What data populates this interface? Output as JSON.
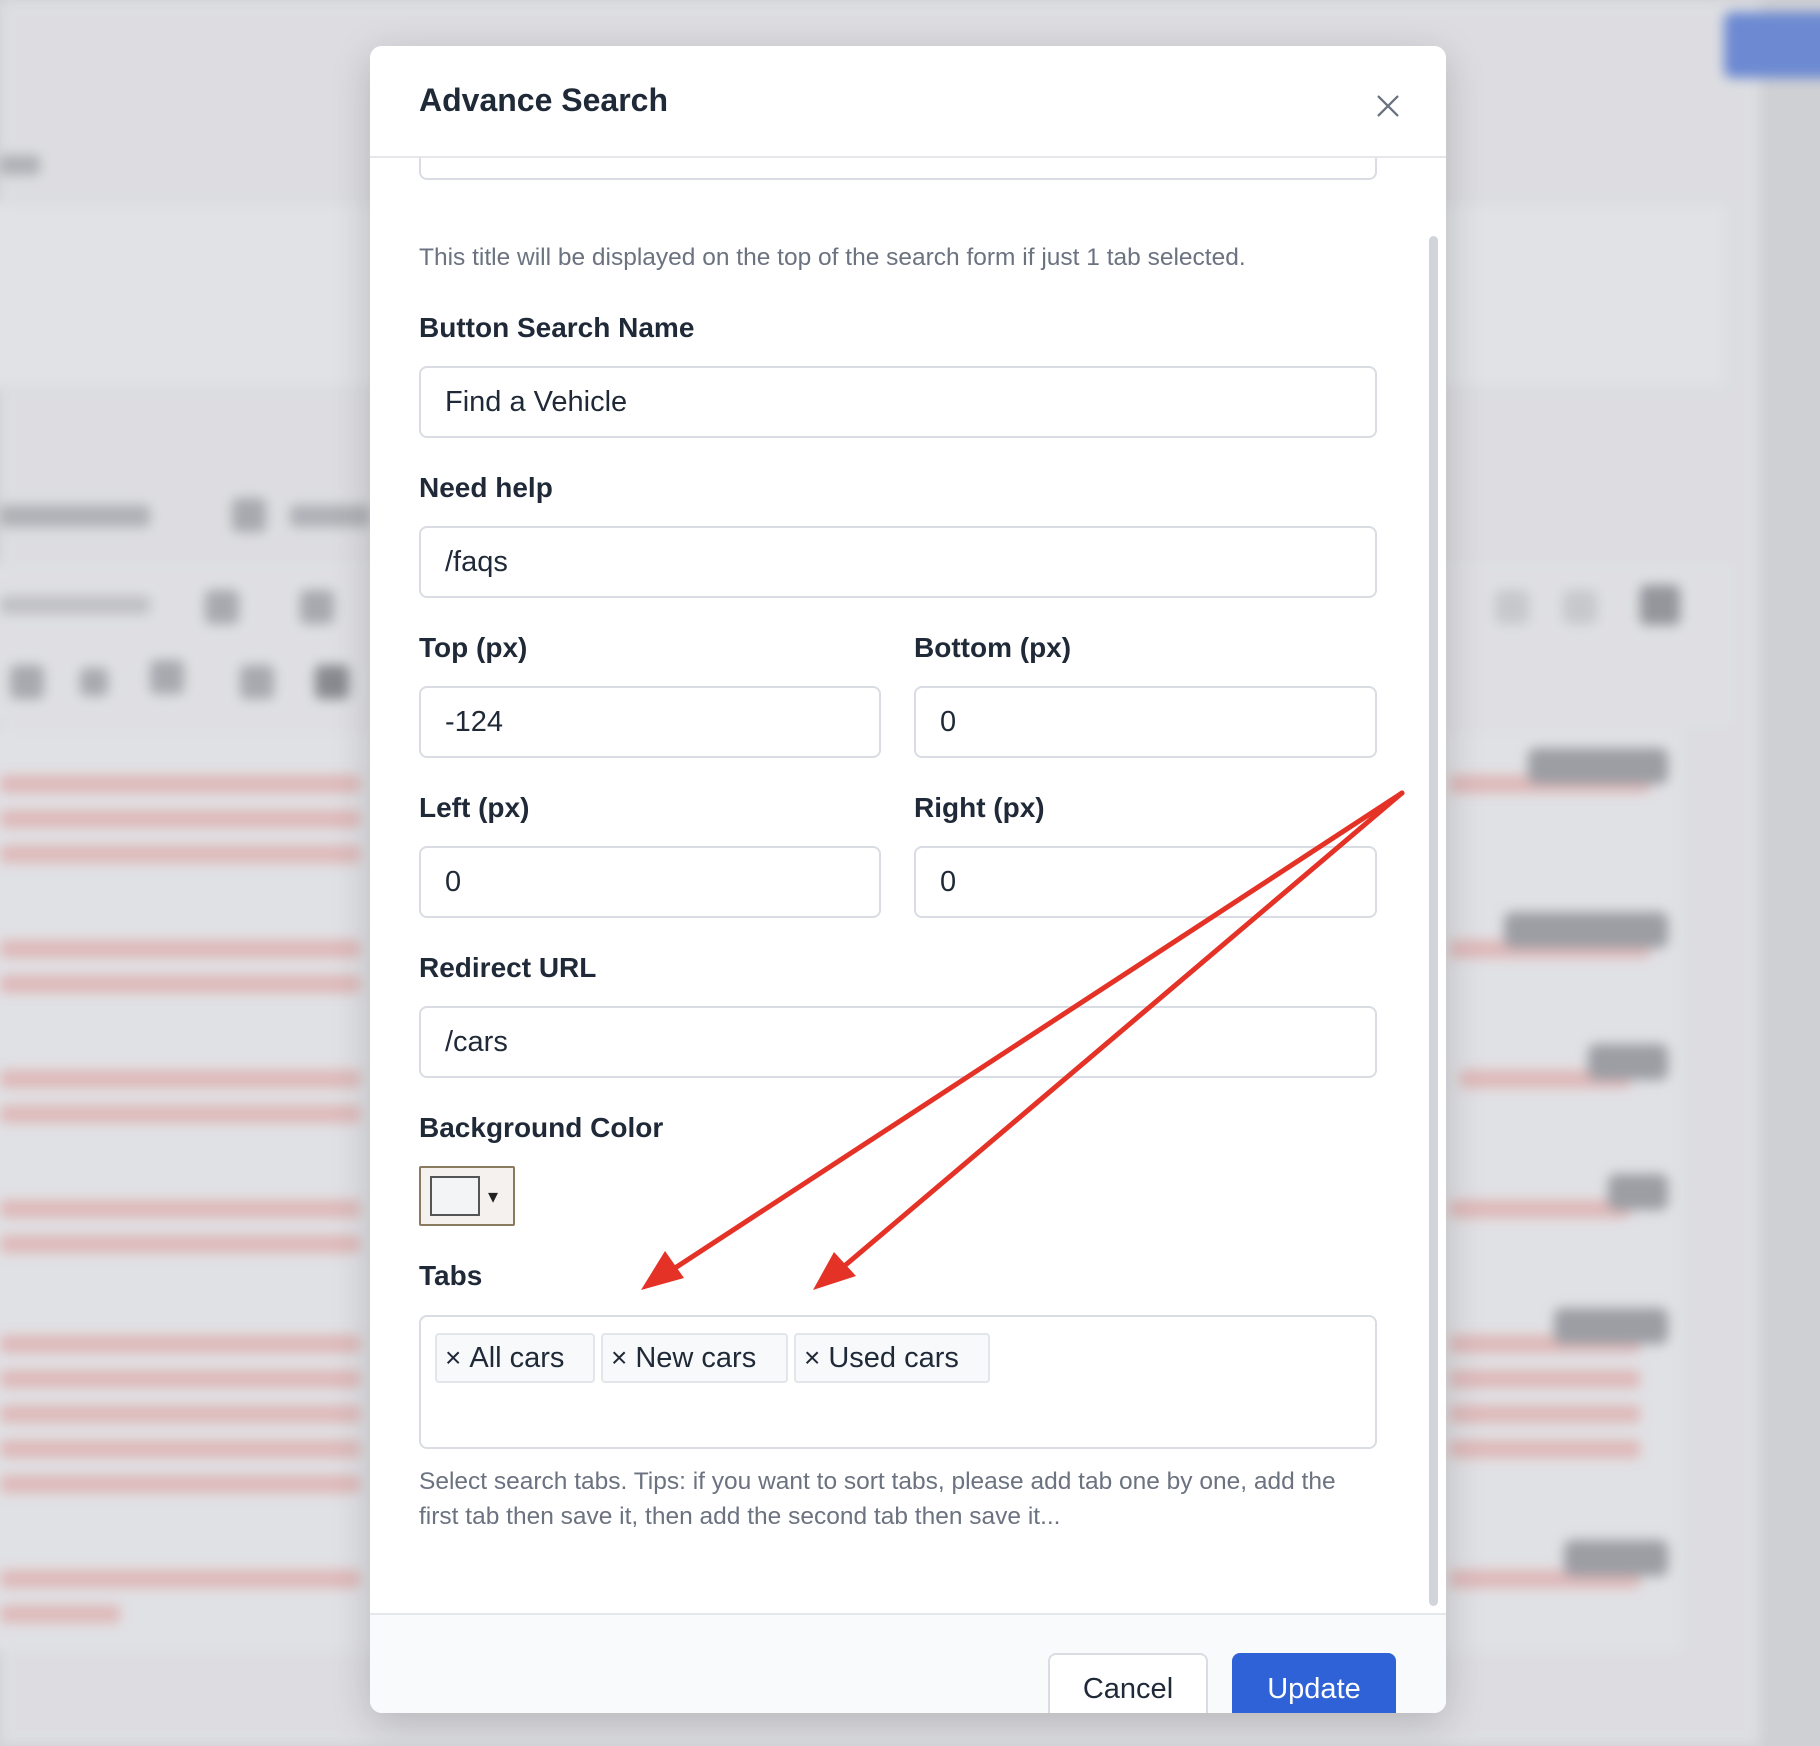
{
  "dialog": {
    "title": "Advance Search",
    "title_hint": "This title will be displayed on the top of the search form if just 1 tab selected."
  },
  "fields": {
    "button_search_name": {
      "label": "Button Search Name",
      "value": "Find a Vehicle"
    },
    "need_help": {
      "label": "Need help",
      "value": "/faqs"
    },
    "top": {
      "label": "Top (px)",
      "value": "-124"
    },
    "bottom": {
      "label": "Bottom (px)",
      "value": "0"
    },
    "left": {
      "label": "Left (px)",
      "value": "0"
    },
    "right": {
      "label": "Right (px)",
      "value": "0"
    },
    "redirect_url": {
      "label": "Redirect URL",
      "value": "/cars"
    },
    "background_color": {
      "label": "Background Color",
      "value": "#f3f4f6",
      "caret": "▾"
    }
  },
  "tabs": {
    "label": "Tabs",
    "remove_glyph": "×",
    "items": [
      {
        "label": "All cars"
      },
      {
        "label": "New cars"
      },
      {
        "label": "Used cars"
      }
    ],
    "hint": "Select search tabs. Tips: if you want to sort tabs, please add tab one by one, add the first tab then save it, then add the second tab then save it..."
  },
  "footer": {
    "cancel_label": "Cancel",
    "update_label": "Update"
  },
  "colors": {
    "primary": "#2f62d6",
    "annotation_arrow": "#e53227"
  }
}
